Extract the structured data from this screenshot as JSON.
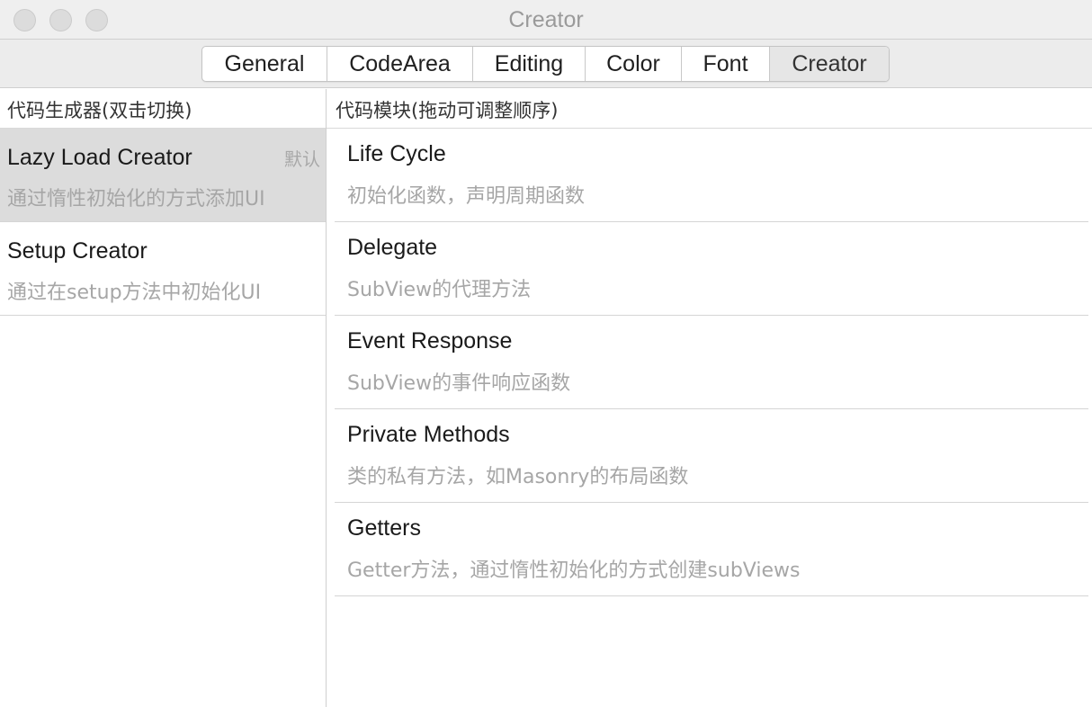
{
  "window": {
    "title": "Creator"
  },
  "tabs": [
    {
      "label": "General",
      "active": false
    },
    {
      "label": "CodeArea",
      "active": false
    },
    {
      "label": "Editing",
      "active": false
    },
    {
      "label": "Color",
      "active": false
    },
    {
      "label": "Font",
      "active": false
    },
    {
      "label": "Creator",
      "active": true
    }
  ],
  "left_pane": {
    "header": "代码生成器(双击切换)",
    "items": [
      {
        "title": "Lazy Load Creator",
        "description": "通过惰性初始化的方式添加UI",
        "badge": "默认",
        "selected": true
      },
      {
        "title": "Setup Creator",
        "description": "通过在setup方法中初始化UI",
        "badge": "",
        "selected": false
      }
    ]
  },
  "right_pane": {
    "header": "代码模块(拖动可调整顺序)",
    "modules": [
      {
        "title": "Life Cycle",
        "description": "初始化函数，声明周期函数"
      },
      {
        "title": "Delegate",
        "description": "SubView的代理方法"
      },
      {
        "title": "Event Response",
        "description": "SubView的事件响应函数"
      },
      {
        "title": "Private Methods",
        "description": "类的私有方法，如Masonry的布局函数"
      },
      {
        "title": "Getters",
        "description": "Getter方法，通过惰性初始化的方式创建subViews"
      }
    ]
  },
  "colors": {
    "selected_row": "#dcdcdc",
    "secondary_text": "#a6a6a6",
    "active_tab": "#e6e6e6"
  }
}
